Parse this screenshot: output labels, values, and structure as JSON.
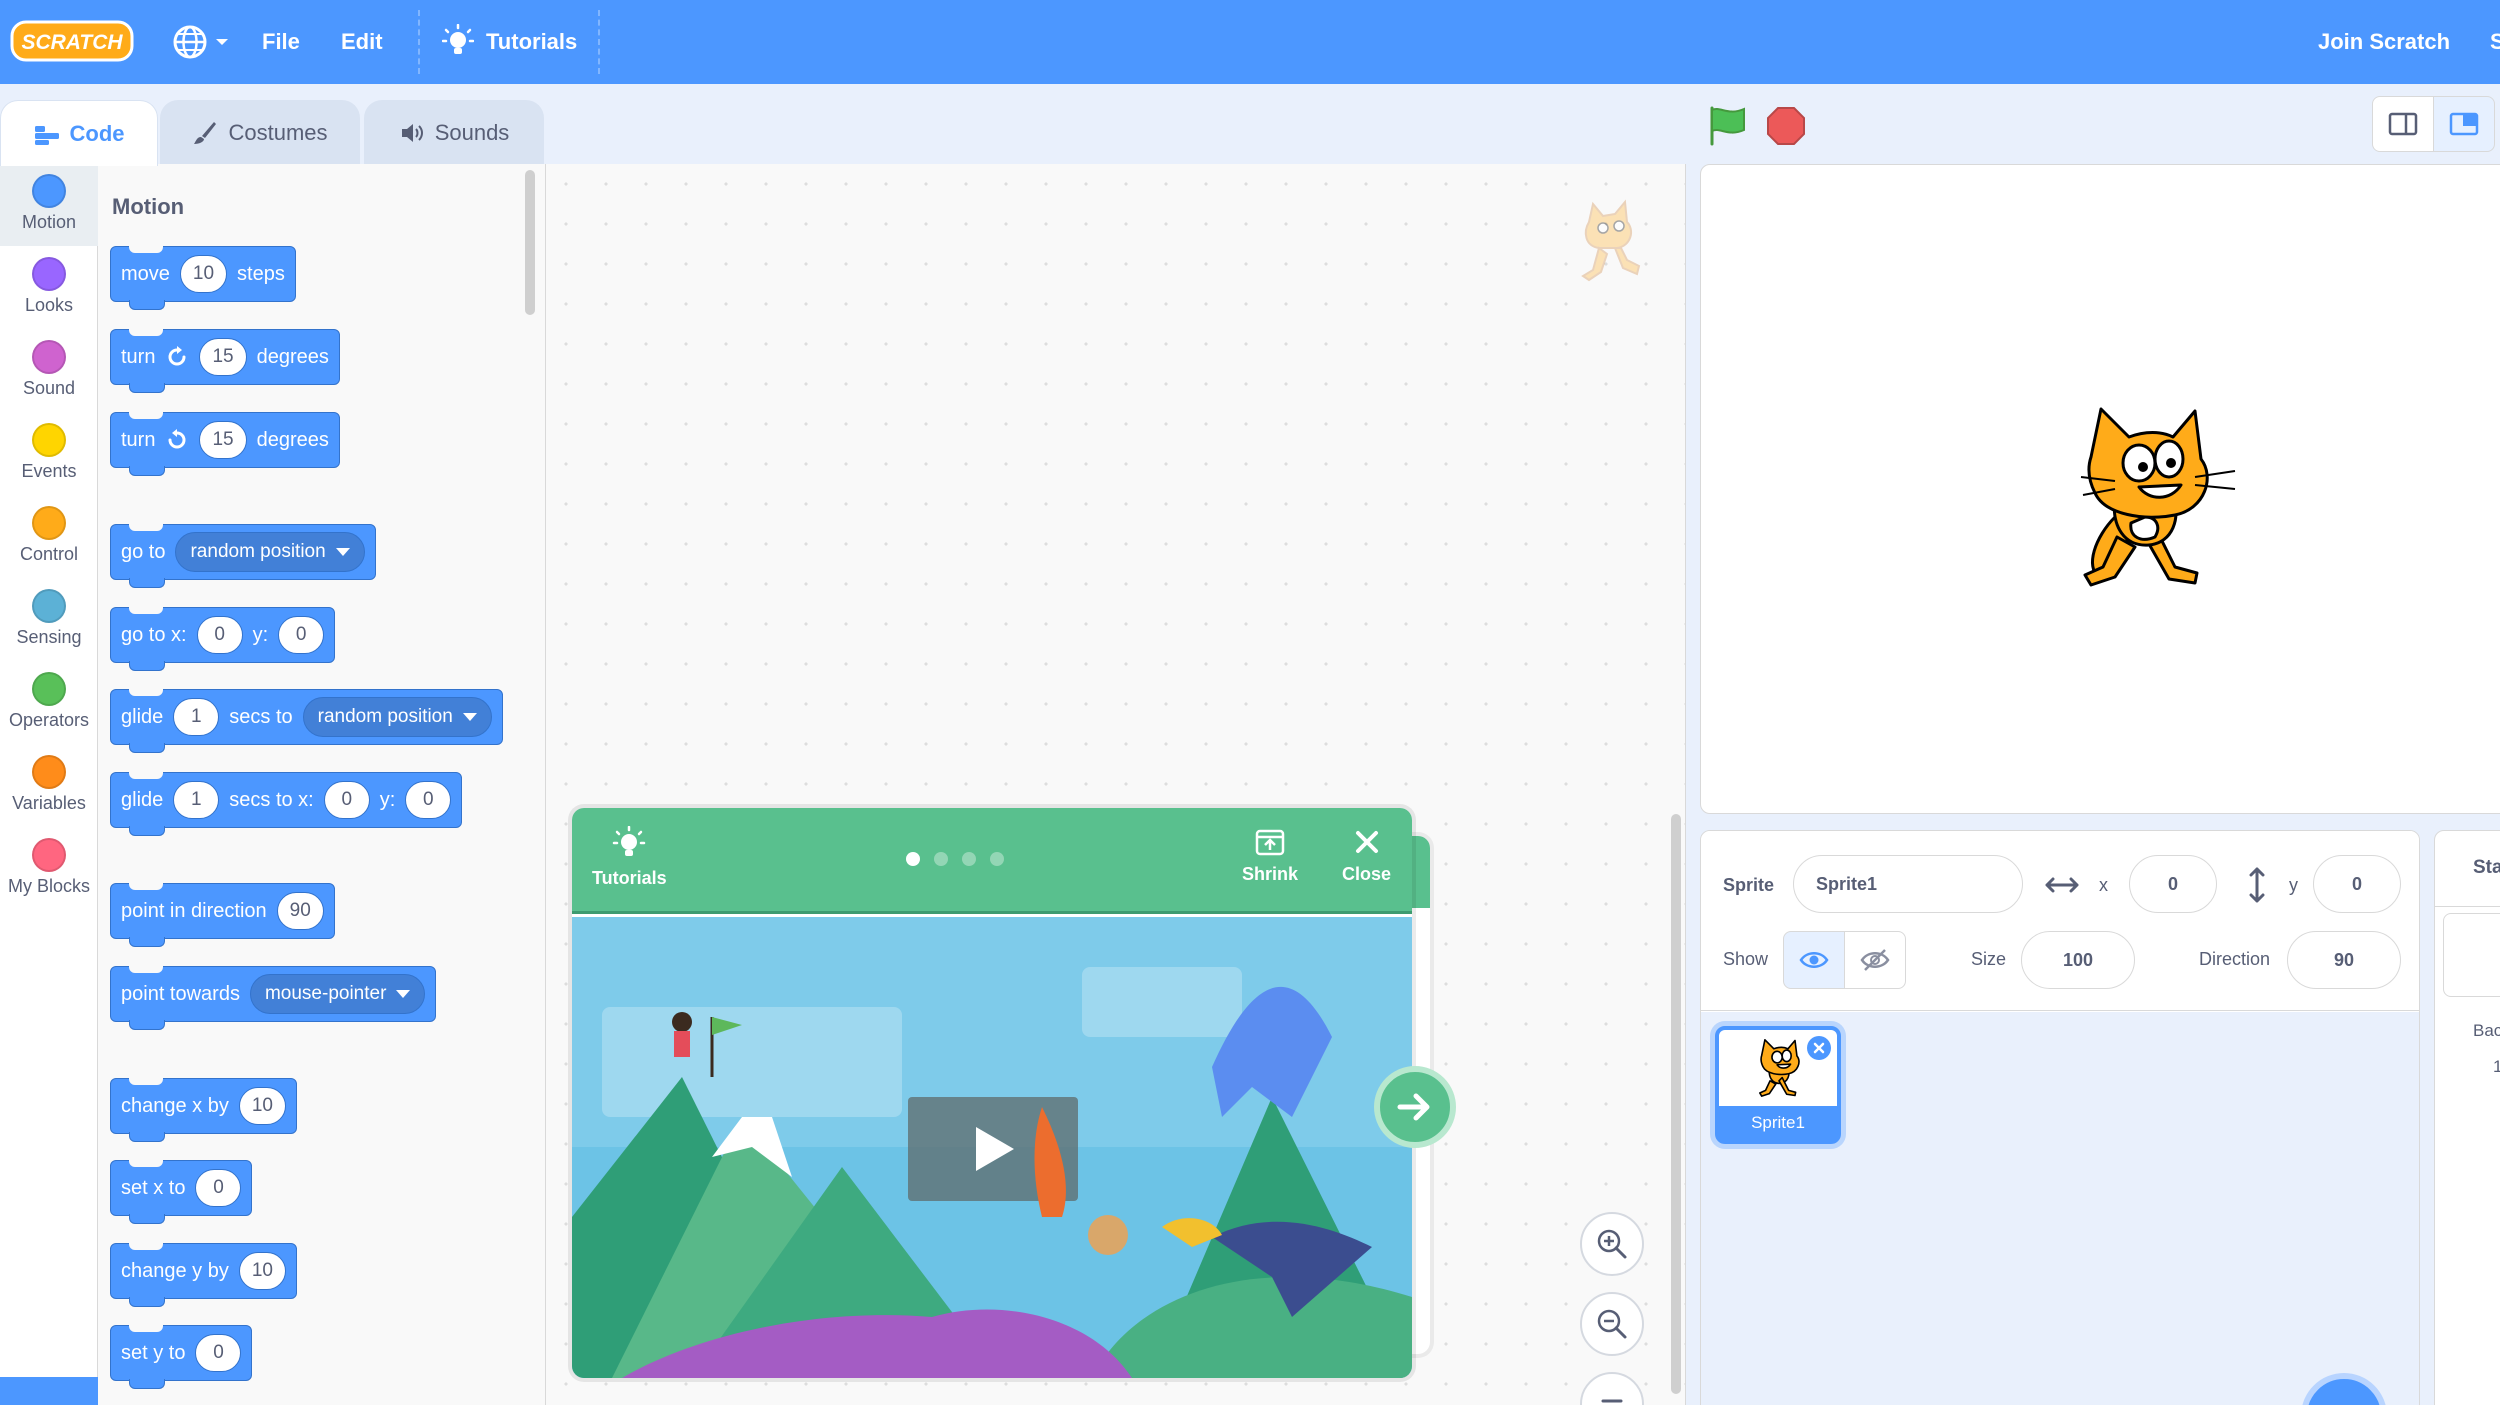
{
  "menubar": {
    "logo_text": "SCRATCH",
    "file": "File",
    "edit": "Edit",
    "tutorials": "Tutorials",
    "join": "Join Scratch",
    "signin_partial": "Si"
  },
  "tabs": [
    {
      "label": "Code"
    },
    {
      "label": "Costumes"
    },
    {
      "label": "Sounds"
    }
  ],
  "categories": [
    {
      "label": "Motion",
      "color": "#4c97ff"
    },
    {
      "label": "Looks",
      "color": "#9966ff"
    },
    {
      "label": "Sound",
      "color": "#cf63cf"
    },
    {
      "label": "Events",
      "color": "#ffd500"
    },
    {
      "label": "Control",
      "color": "#ffab19"
    },
    {
      "label": "Sensing",
      "color": "#5cb1d6"
    },
    {
      "label": "Operators",
      "color": "#59c059"
    },
    {
      "label": "Variables",
      "color": "#ff8c1a"
    },
    {
      "label": "My Blocks",
      "color": "#ff6680"
    }
  ],
  "palette": {
    "title": "Motion",
    "blocks": {
      "move": {
        "a": "move",
        "v": "10",
        "b": "steps"
      },
      "turn_right": {
        "a": "turn",
        "v": "15",
        "b": "degrees"
      },
      "turn_left": {
        "a": "turn",
        "v": "15",
        "b": "degrees"
      },
      "goto": {
        "a": "go to",
        "menu": "random position"
      },
      "goto_xy": {
        "a": "go to x:",
        "x": "0",
        "b": "y:",
        "y": "0"
      },
      "glide_to": {
        "a": "glide",
        "v": "1",
        "b": "secs to",
        "menu": "random position"
      },
      "glide_xy": {
        "a": "glide",
        "v": "1",
        "b": "secs to x:",
        "x": "0",
        "c": "y:",
        "y": "0"
      },
      "point_dir": {
        "a": "point in direction",
        "v": "90"
      },
      "point_towards": {
        "a": "point towards",
        "menu": "mouse-pointer"
      },
      "change_x": {
        "a": "change x by",
        "v": "10"
      },
      "set_x": {
        "a": "set x to",
        "v": "0"
      },
      "change_y": {
        "a": "change y by",
        "v": "10"
      },
      "set_y": {
        "a": "set y to",
        "v": "0"
      }
    }
  },
  "tutorial": {
    "tutorials_label": "Tutorials",
    "shrink_label": "Shrink",
    "close_label": "Close",
    "page_count": 4,
    "current_page": 1
  },
  "sprite_info": {
    "sprite_label": "Sprite",
    "sprite_name": "Sprite1",
    "x_label": "x",
    "x_value": "0",
    "y_label": "y",
    "y_value": "0",
    "show_label": "Show",
    "size_label": "Size",
    "size_value": "100",
    "direction_label": "Direction",
    "direction_value": "90"
  },
  "sprites": [
    {
      "name": "Sprite1",
      "selected": true
    }
  ],
  "stage_target": {
    "header_partial": "Sta",
    "backdrops_partial": "Backd",
    "backdrop_count_partial": "1"
  },
  "colors": {
    "menubar": "#4c97ff",
    "motion": "#4c97ff",
    "tutorial_green": "#59c08e"
  }
}
